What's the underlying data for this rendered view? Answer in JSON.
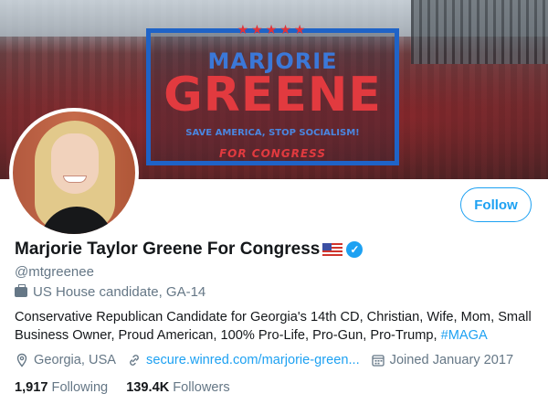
{
  "banner": {
    "sign_first_name": "MARJORIE",
    "sign_last_name": "GREENE",
    "sign_slogan": "SAVE AMERICA, STOP SOCIALISM!",
    "sign_tagline": "FOR CONGRESS",
    "sign_stars": "★★★★★"
  },
  "profile": {
    "display_name": "Marjorie Taylor Greene For Congress",
    "handle": "@mtgreenee",
    "category": "US House candidate, GA-14",
    "bio_text": "Conservative Republican Candidate for Georgia's 14th CD, Christian, Wife, Mom, Small Business Owner, Proud American, 100% Pro-Life, Pro-Gun, Pro-Trump, ",
    "bio_hashtag": "#MAGA",
    "location": "Georgia, USA",
    "website": "secure.winred.com/marjorie-green...",
    "joined": "Joined January 2017",
    "verified_glyph": "✓"
  },
  "actions": {
    "follow_label": "Follow"
  },
  "stats": {
    "following_count": "1,917",
    "following_label": "Following",
    "followers_count": "139.4K",
    "followers_label": "Followers"
  },
  "colors": {
    "accent": "#1da1f2",
    "secondary_text": "#657786",
    "sign_blue": "#1f63c7",
    "sign_red": "#e23a3f"
  }
}
